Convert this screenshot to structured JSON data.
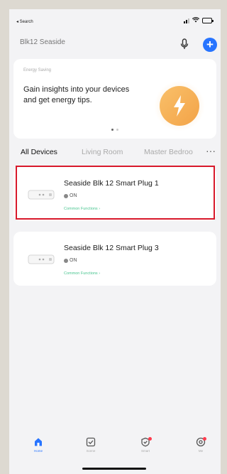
{
  "status_bar": {
    "back_label": "◂ Search"
  },
  "header": {
    "home_name": "Blk12 Seaside"
  },
  "energy_card": {
    "small_label": "Energy Saving",
    "message": "Gain insights into your devices and get energy tips."
  },
  "tabs": [
    {
      "label": "All Devices",
      "active": true
    },
    {
      "label": "Living Room",
      "active": false
    },
    {
      "label": "Master Bedroo",
      "active": false
    }
  ],
  "more_label": "···",
  "devices": [
    {
      "name": "Seaside Blk 12 Smart Plug 1",
      "status": "ON",
      "link": "Common Functions ›",
      "highlighted": true
    },
    {
      "name": "Seaside Blk 12 Smart Plug 3",
      "status": "ON",
      "link": "Common Functions ›",
      "highlighted": false
    }
  ],
  "bottom_nav": [
    {
      "label": "Home",
      "icon": "home-icon",
      "active": true
    },
    {
      "label": "Scene",
      "icon": "scene-icon",
      "active": false
    },
    {
      "label": "Smart",
      "icon": "smart-icon",
      "active": false,
      "badge": true
    },
    {
      "label": "Me",
      "icon": "me-icon",
      "active": false,
      "badge": true
    }
  ],
  "colors": {
    "accent": "#2774ff",
    "highlight": "#d8192b",
    "link": "#49c590",
    "energy": "#f3a347"
  }
}
